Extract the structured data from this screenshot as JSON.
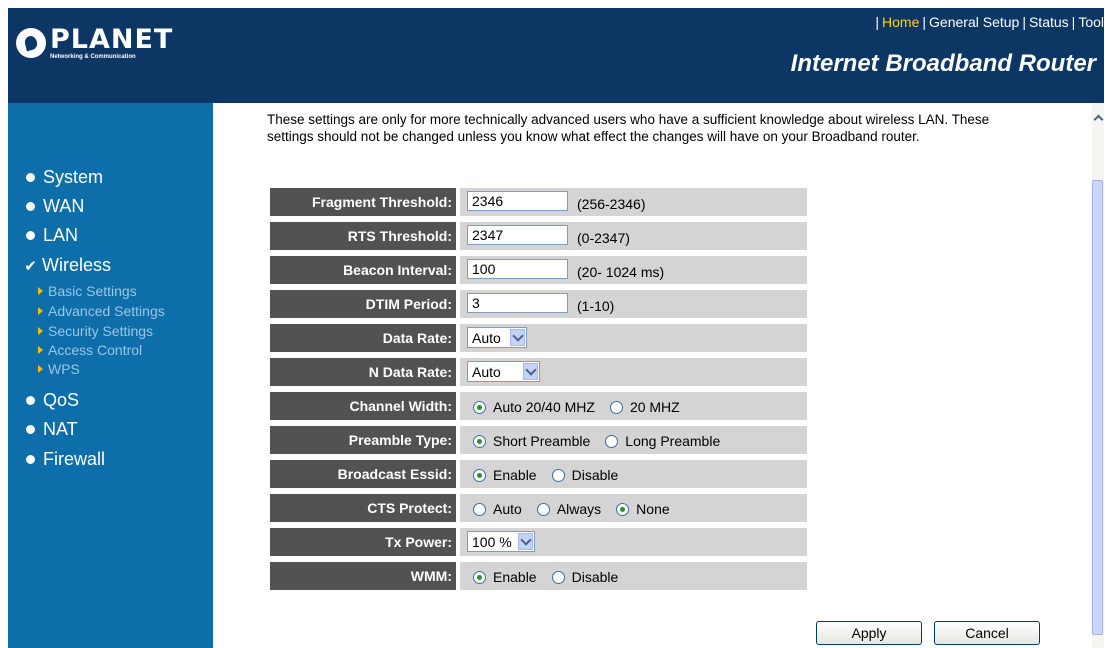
{
  "brand": {
    "logo_text": "PLANET",
    "logo_sub": "Networking & Communication"
  },
  "topnav": {
    "home": "Home",
    "general_setup": "General Setup",
    "status": "Status",
    "tools": "Tool",
    "separator": "|"
  },
  "product_title": "Internet Broadband Router",
  "sidebar": {
    "items": [
      {
        "label": "System"
      },
      {
        "label": "WAN"
      },
      {
        "label": "LAN"
      },
      {
        "label": "Wireless"
      },
      {
        "label": "QoS"
      },
      {
        "label": "NAT"
      },
      {
        "label": "Firewall"
      }
    ],
    "wireless_sub": [
      {
        "label": "Basic Settings"
      },
      {
        "label": "Advanced Settings"
      },
      {
        "label": "Security Settings"
      },
      {
        "label": "Access Control"
      },
      {
        "label": "WPS"
      }
    ]
  },
  "description": "These settings are only for more technically advanced users who have a sufficient knowledge about wireless LAN. These settings should not be changed unless you know what effect the changes will have on your Broadband router.",
  "settings": {
    "fragment_threshold": {
      "label": "Fragment Threshold:",
      "value": "2346",
      "range": "(256-2346)"
    },
    "rts_threshold": {
      "label": "RTS Threshold:",
      "value": "2347",
      "range": "(0-2347)"
    },
    "beacon_interval": {
      "label": "Beacon Interval:",
      "value": "100",
      "range": "(20- 1024 ms)"
    },
    "dtim_period": {
      "label": "DTIM Period:",
      "value": "3",
      "range": "(1-10)"
    },
    "data_rate": {
      "label": "Data Rate:",
      "value": "Auto"
    },
    "n_data_rate": {
      "label": "N Data Rate:",
      "value": "Auto"
    },
    "channel_width": {
      "label": "Channel Width:",
      "options": [
        "Auto 20/40 MHZ",
        "20 MHZ"
      ],
      "selected": 0
    },
    "preamble_type": {
      "label": "Preamble Type:",
      "options": [
        "Short Preamble",
        "Long Preamble"
      ],
      "selected": 0
    },
    "broadcast_essid": {
      "label": "Broadcast Essid:",
      "options": [
        "Enable",
        "Disable"
      ],
      "selected": 0
    },
    "cts_protect": {
      "label": "CTS Protect:",
      "options": [
        "Auto",
        "Always",
        "None"
      ],
      "selected": 2
    },
    "tx_power": {
      "label": "Tx Power:",
      "value": "100 %"
    },
    "wmm": {
      "label": "WMM:",
      "options": [
        "Enable",
        "Disable"
      ],
      "selected": 0
    }
  },
  "buttons": {
    "apply": "Apply",
    "cancel": "Cancel"
  },
  "colors": {
    "header_bg": "#0c3664",
    "sidebar_bg": "#0d6ea9",
    "label_bg": "#525252",
    "value_bg": "#d4d4d4",
    "active_link": "#ffd400"
  }
}
